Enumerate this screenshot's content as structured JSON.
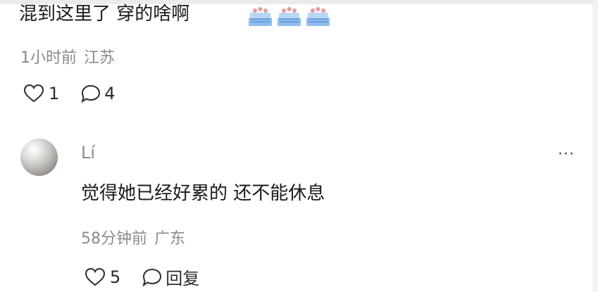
{
  "comment_prev": {
    "text": "混到这里了 穿的啥啊",
    "emojis": [
      "cake-icon",
      "cake-icon",
      "cake-icon"
    ],
    "time": "1小时前",
    "location": "江苏",
    "likes": "1",
    "replies": "4"
  },
  "comment": {
    "username": "Lí",
    "text": "觉得她已经好累的 还不能休息",
    "time": "58分钟前",
    "location": "广东",
    "likes": "5",
    "reply_label": "回复",
    "more_label": "···"
  },
  "colors": {
    "text": "#1a1a1a",
    "meta": "#8a8a8a",
    "emoji_base": "#6fa8e8",
    "emoji_top": "#e8a0a0"
  }
}
